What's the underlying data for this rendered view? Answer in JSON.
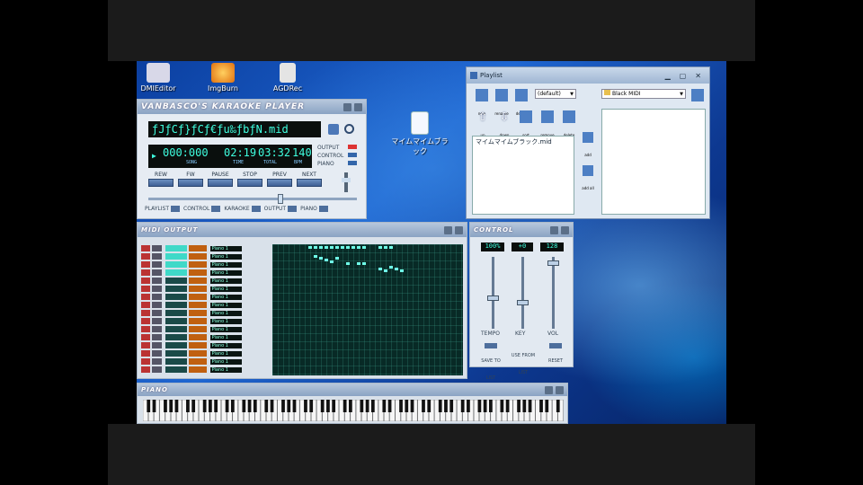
{
  "desktop": {
    "icons": [
      {
        "label": "DMIEditor",
        "color": "#d8d8e8"
      },
      {
        "label": "ImgBurn",
        "color": "#f0a020"
      },
      {
        "label": "AGDRec",
        "color": "#e0e0e0"
      }
    ],
    "file_icon_label": "マイムマイムブラック"
  },
  "karaoke": {
    "title": "VANBASCO'S KARAOKE PLAYER",
    "song_name": "ƒJƒCƒ}ƒCƒ€ƒu‰ƒbƒN.mid",
    "song_time": "000:000",
    "time": "02:19",
    "total": "03:32",
    "bpm": "140",
    "song_label": "SONG",
    "time_label": "TIME",
    "total_label": "TOTAL",
    "bpm_label": "BPM",
    "side_labels": [
      "OUTPUT",
      "CONTROL",
      "PIANO"
    ],
    "buttons": [
      "REW",
      "FW",
      "PAUSE",
      "STOP",
      "PREV",
      "NEXT"
    ],
    "toggles": [
      "PLAYLIST",
      "CONTROL",
      "KARAOKE",
      "OUTPUT",
      "PIANO"
    ]
  },
  "midi_output": {
    "title": "MIDI OUTPUT",
    "instruments": [
      "Piano 1",
      "Piano 1",
      "Piano 1",
      "Piano 1",
      "Piano 1",
      "Piano 1",
      "Piano 1",
      "Piano 1",
      "Piano 1",
      "Piano 1",
      "Piano 1",
      "Piano 1",
      "Piano 1",
      "Piano 1",
      "Piano 1",
      "Piano 1"
    ]
  },
  "control": {
    "title": "CONTROL",
    "values": [
      "100%",
      "+0",
      "128"
    ],
    "slider_labels": [
      "TEMPO",
      "KEY",
      "VOL"
    ],
    "levels": [
      0.42,
      0.35,
      0.95
    ],
    "bottom_buttons": [
      "SAVE TO LIST",
      "USE FROM LIST",
      "RESET"
    ]
  },
  "piano": {
    "title": "PIANO"
  },
  "playlist": {
    "title": "Playlist",
    "top_buttons": [
      "new",
      "rename",
      "delete"
    ],
    "second_buttons": [
      "up",
      "down",
      "sort",
      "remove",
      "delete"
    ],
    "list_select": "(default)",
    "folder_select": "Black MIDI",
    "items": [
      "マイムマイムブラック.mid"
    ],
    "side_buttons": [
      "add",
      "add all"
    ]
  }
}
